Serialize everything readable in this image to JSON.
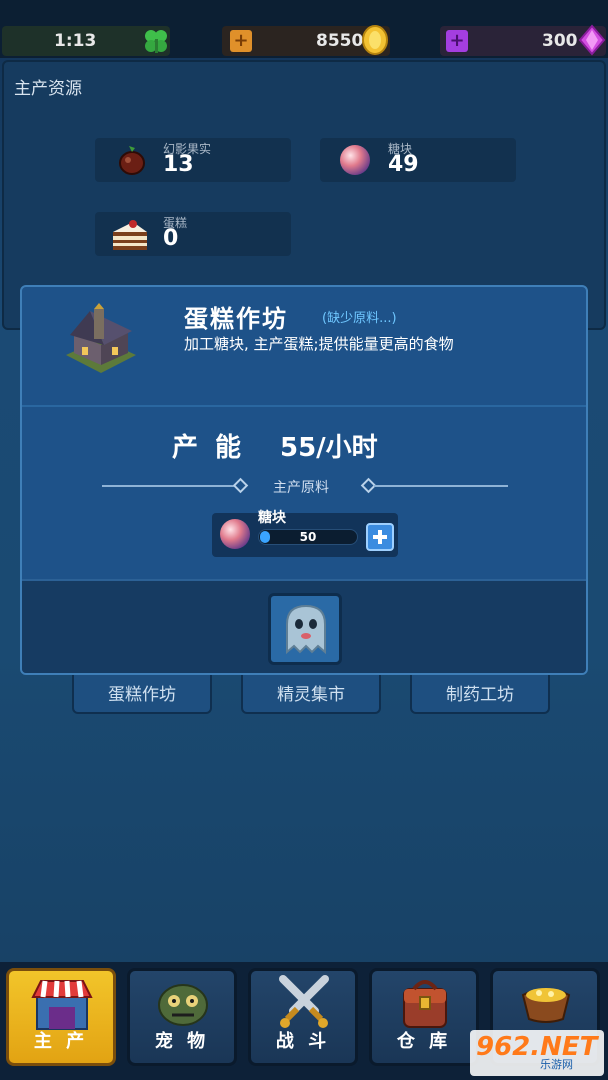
{
  "topbar": {
    "timer": "1:13",
    "gold": "8550",
    "gems": "300",
    "clover_icon": "clover-icon",
    "coin_icon": "gold-coin-icon",
    "gem_icon": "purple-gem-icon"
  },
  "resources": {
    "title": "主产资源",
    "items": [
      {
        "name": "幻影果实",
        "count": "13",
        "icon": "phantom-fruit-icon"
      },
      {
        "name": "糖块",
        "count": "49",
        "icon": "candy-ball-icon"
      },
      {
        "name": "蛋糕",
        "count": "0",
        "icon": "cake-icon"
      }
    ]
  },
  "workshop": {
    "name": "蛋糕作坊",
    "status": "(缺少原料...)",
    "description": "加工糖块, 主产蛋糕;提供能量更高的食物",
    "capacity_label": "产 能",
    "capacity_value": "55/小时",
    "material_section_label": "主产原料",
    "material": {
      "name": "糖块",
      "quantity": "50",
      "fill_fraction": 0.1
    }
  },
  "tabs": [
    {
      "label": "蛋糕作坊"
    },
    {
      "label": "精灵集市"
    },
    {
      "label": "制药工坊"
    }
  ],
  "nav": [
    {
      "label": "主 产",
      "active": true,
      "icon": "shop-icon"
    },
    {
      "label": "宠 物",
      "active": false,
      "icon": "pet-icon"
    },
    {
      "label": "战 斗",
      "active": false,
      "icon": "crossed-swords-icon"
    },
    {
      "label": "仓 库",
      "active": false,
      "icon": "backpack-icon"
    },
    {
      "label": "",
      "active": false,
      "icon": "treasure-bag-icon"
    }
  ],
  "watermark": {
    "brand": "962.NET",
    "sub": "乐游网"
  }
}
